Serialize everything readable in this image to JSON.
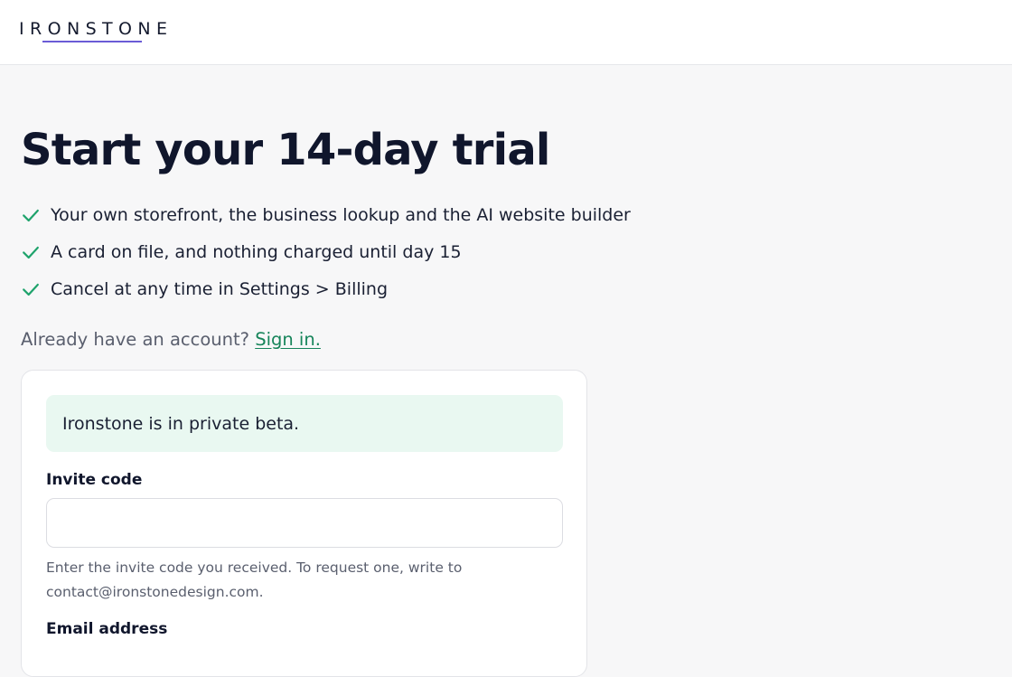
{
  "header": {
    "logo_text": "IRONSTONE"
  },
  "hero": {
    "title": "Start your 14-day trial",
    "features": [
      "Your own storefront, the business lookup and the AI website builder",
      "A card on file, and nothing charged until day 15",
      "Cancel at any time in Settings > Billing"
    ]
  },
  "signin": {
    "prompt": "Already have an account?",
    "link_label": "Sign in."
  },
  "form": {
    "beta_notice": "Ironstone is in private beta.",
    "invite_code": {
      "label": "Invite code",
      "value": "",
      "help": "Enter the invite code you received. To request one, write to contact@ironstonedesign.com."
    },
    "email": {
      "label": "Email address"
    }
  },
  "colors": {
    "accent": "#16845a",
    "check": "#1fa36c",
    "logo_underline": "#6a5bd6",
    "beta_bg": "#e9f8f1"
  }
}
